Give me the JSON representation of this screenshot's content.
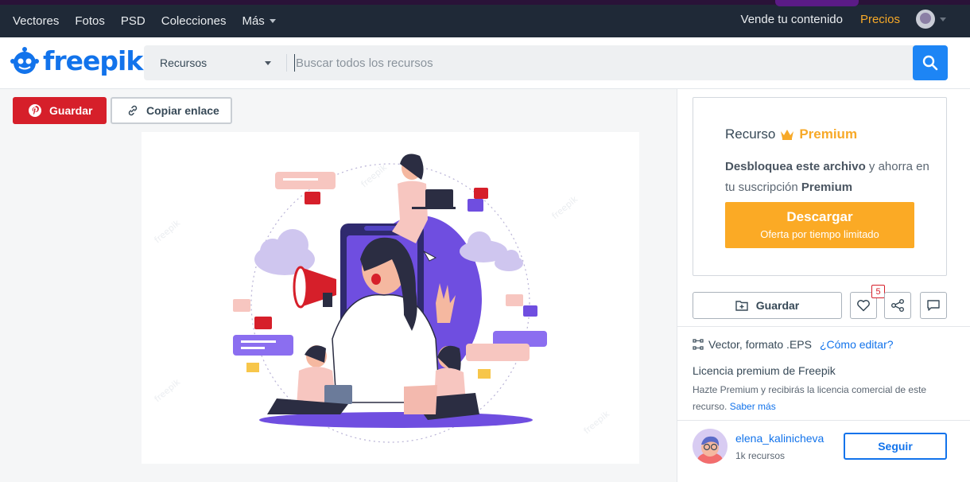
{
  "topnav": {
    "links": [
      "Vectores",
      "Fotos",
      "PSD",
      "Colecciones",
      "Más"
    ],
    "sell_label": "Vende tu contenido",
    "pricing_label": "Precios"
  },
  "header": {
    "logo_text": "freepik",
    "search": {
      "category": "Recursos",
      "placeholder": "Buscar todos los recursos"
    }
  },
  "actions_left": {
    "pinterest_label": "Guardar",
    "copy_link_label": "Copiar enlace"
  },
  "premium_card": {
    "title_prefix": "Recurso",
    "title_premium": "Premium",
    "desc_bold": "Desbloquea este archivo",
    "desc_mid": " y ahorra en tu suscripción ",
    "desc_end": "Premium",
    "download_label": "Descargar",
    "download_sub": "Oferta por tiempo limitado"
  },
  "actions_right": {
    "save_label": "Guardar",
    "likes_count": "5"
  },
  "file_info": {
    "format": "Vector, formato .EPS",
    "edit_link": "¿Cómo editar?"
  },
  "license": {
    "title": "Licencia premium de Freepik",
    "text": "Hazte Premium y recibirás la licencia comercial de este recurso.",
    "more_link": "Saber más"
  },
  "author": {
    "name": "elena_kalinicheva",
    "resources": "1k recursos",
    "follow_label": "Seguir"
  },
  "colors": {
    "brand_blue": "#1273eb",
    "premium_orange": "#fbaa25",
    "pinterest_red": "#d61f2a",
    "topbar": "#1f2937"
  }
}
